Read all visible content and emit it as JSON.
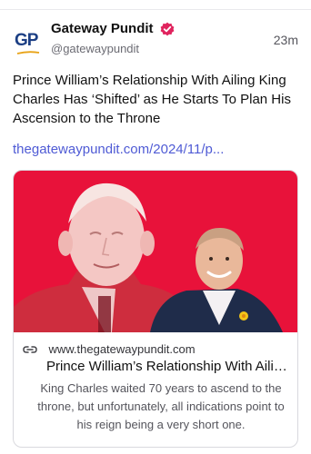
{
  "post": {
    "author": {
      "logo_text": "GP",
      "display_name": "Gateway Pundit",
      "handle": "@gatewaypundit",
      "verified_icon": "verified-badge-icon"
    },
    "timestamp": "23m",
    "text": "Prince William’s Relationship With Ailing King Charles Has ‘Shifted’ as He Starts To Plan His Ascension to the Throne",
    "link_text": "thegatewaypundit.com/2024/11/p..."
  },
  "card": {
    "image_icon": "news-photo",
    "link_icon": "link-icon",
    "domain": "www.thegatewaypundit.com",
    "title": "Prince William’s Relationship With Ailing King Charles Has ‘Shifted’ as He Starts To Plan His Ascension to the Throne",
    "description": "King Charles waited 70 years to ascend to the throne, but unfortunately, all indications point to his reign being a very short one."
  },
  "colors": {
    "accent_link": "#4f5bd5",
    "verified": "#e0245e",
    "image_bg": "#e8123a",
    "logo": "#1c3f84"
  }
}
